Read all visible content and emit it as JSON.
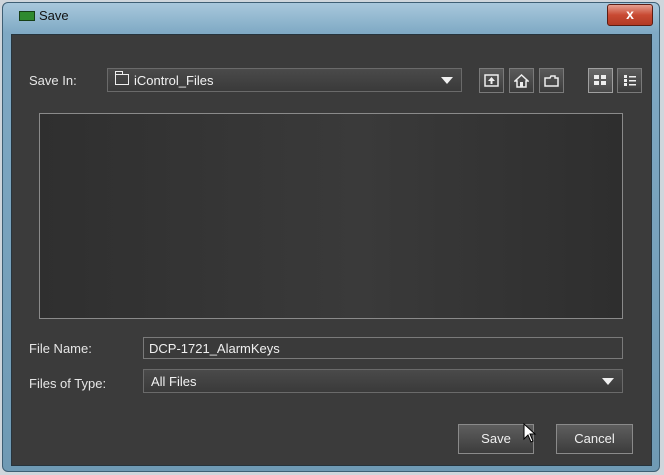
{
  "window": {
    "title": "Save",
    "close_label": "x"
  },
  "save_in": {
    "label": "Save In:",
    "value": "iControl_Files"
  },
  "toolbar": {
    "icons": [
      "up-folder-icon",
      "home-icon",
      "new-folder-icon",
      "list-view-icon",
      "details-view-icon"
    ]
  },
  "file_name": {
    "label": "File Name:",
    "value": "DCP-1721_AlarmKeys"
  },
  "files_of_type": {
    "label": "Files of Type:",
    "value": "All Files"
  },
  "buttons": {
    "save": "Save",
    "cancel": "Cancel"
  },
  "colors": {
    "dialog_bg": "#3b3b3b",
    "titlebar": "#7fa9c4",
    "close": "#c84a33"
  }
}
